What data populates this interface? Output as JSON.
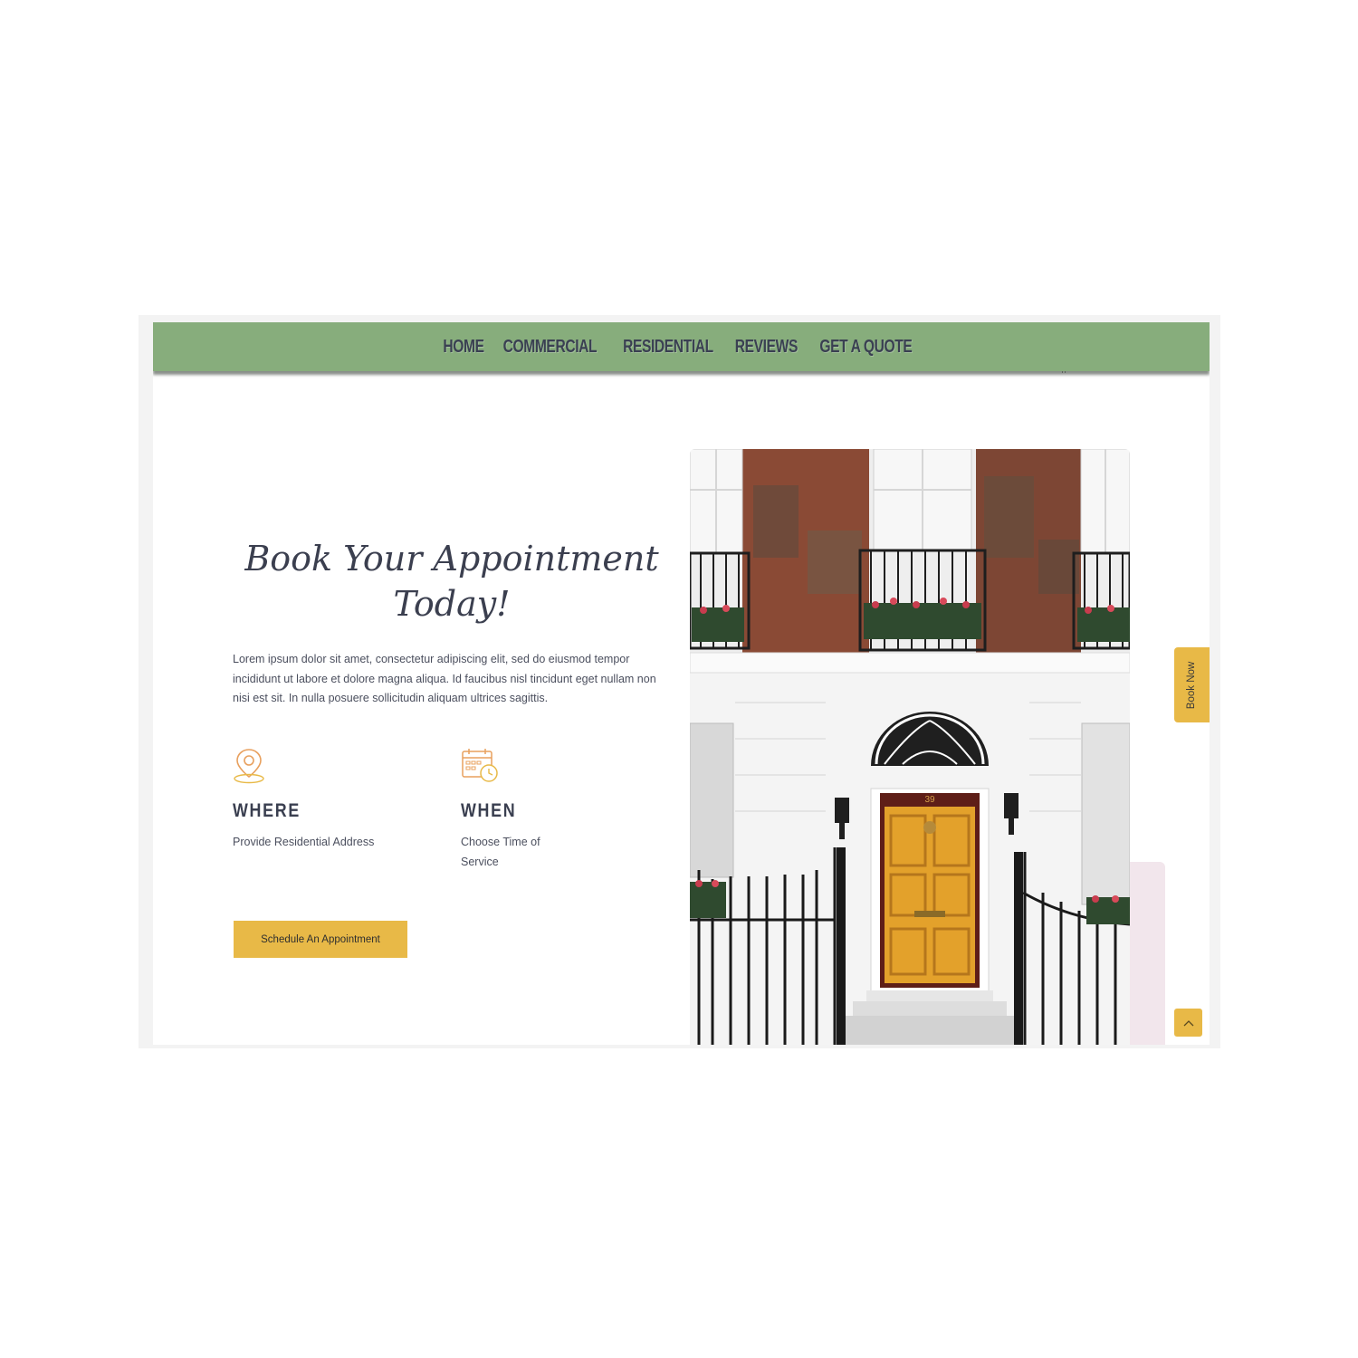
{
  "nav": {
    "items": [
      {
        "label": "HOME"
      },
      {
        "label": "COMMERCIAL"
      },
      {
        "label": "RESIDENTIAL"
      },
      {
        "label": "REVIEWS"
      },
      {
        "label": "GET A QUOTE"
      }
    ]
  },
  "hero": {
    "heading": "Book Your Appointment Today!",
    "body": "Lorem ipsum dolor sit amet, consectetur adipiscing elit, sed do eiusmod tempor incididunt ut labore et dolore magna aliqua. Id faucibus nisl tincidunt eget nullam non nisi est sit. In nulla posuere sollicitudin aliquam ultrices sagittis."
  },
  "features": {
    "where": {
      "icon": "location-pin-icon",
      "title": "WHERE",
      "desc": "Provide Residential Address"
    },
    "when": {
      "icon": "calendar-clock-icon",
      "title": "WHEN",
      "desc": "Choose Time of Service"
    }
  },
  "cta": {
    "label": "Schedule An Appointment"
  },
  "side_tab": {
    "label": "Book Now"
  },
  "photo": {
    "house_number": "39"
  },
  "colors": {
    "nav_bg": "#87ad7c",
    "accent": "#e8b947",
    "text": "#3d4150",
    "pink": "#f2e6ec"
  }
}
